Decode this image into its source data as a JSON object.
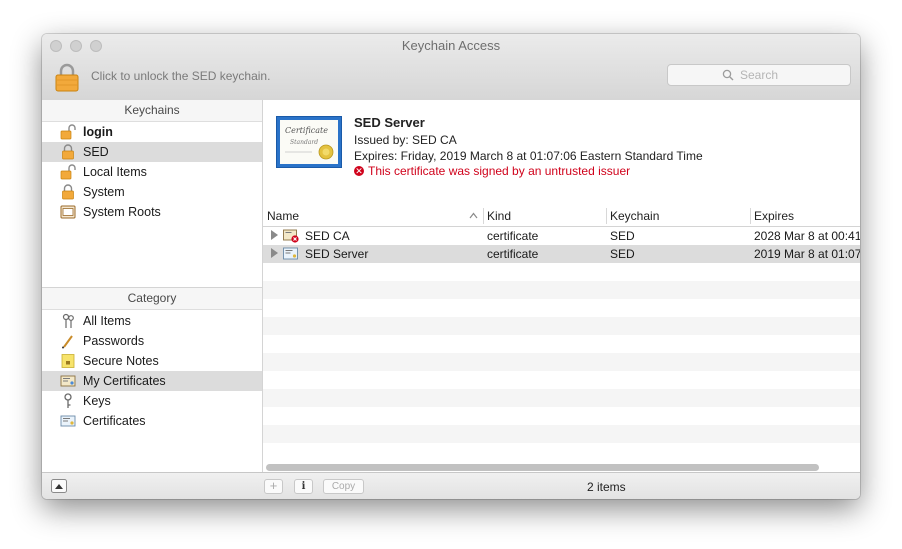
{
  "window": {
    "title": "Keychain Access"
  },
  "toolbar": {
    "unlock_text": "Click to unlock the SED keychain.",
    "search_placeholder": "Search"
  },
  "sidebar": {
    "keychains_header": "Keychains",
    "keychains": [
      {
        "label": "login",
        "icon": "lock-open-icon",
        "bold": true,
        "selected": false
      },
      {
        "label": "SED",
        "icon": "lock-closed-icon",
        "bold": false,
        "selected": true
      },
      {
        "label": "Local Items",
        "icon": "lock-open-icon",
        "bold": false,
        "selected": false
      },
      {
        "label": "System",
        "icon": "lock-closed-icon",
        "bold": false,
        "selected": false
      },
      {
        "label": "System Roots",
        "icon": "cabinet-icon",
        "bold": false,
        "selected": false
      }
    ],
    "category_header": "Category",
    "categories": [
      {
        "label": "All Items",
        "icon": "keys-icon",
        "selected": false
      },
      {
        "label": "Passwords",
        "icon": "pencil-icon",
        "selected": false
      },
      {
        "label": "Secure Notes",
        "icon": "note-icon",
        "selected": false
      },
      {
        "label": "My Certificates",
        "icon": "my-certificate-icon",
        "selected": true
      },
      {
        "label": "Keys",
        "icon": "key-icon",
        "selected": false
      },
      {
        "label": "Certificates",
        "icon": "certificate-icon",
        "selected": false
      }
    ]
  },
  "detail": {
    "name": "SED Server",
    "issued_by": "Issued by: SED CA",
    "expires": "Expires: Friday, 2019 March 8 at 01:07:06 Eastern Standard Time",
    "warning": "This certificate was signed by an untrusted issuer",
    "cert_image_text_1": "Certificate",
    "cert_image_text_2": "Standard"
  },
  "table": {
    "columns": [
      "Name",
      "Kind",
      "Keychain",
      "Expires"
    ],
    "rows": [
      {
        "name": "SED CA",
        "kind": "certificate",
        "keychain": "SED",
        "expires": "2028 Mar 8 at 00:41:",
        "icon": "ca-certificate-icon",
        "selected": false
      },
      {
        "name": "SED Server",
        "kind": "certificate",
        "keychain": "SED",
        "expires": "2019 Mar 8 at 01:07:",
        "icon": "certificate-icon",
        "selected": true
      }
    ]
  },
  "bottombar": {
    "add_label": "+",
    "info_label": "i",
    "copy_label": "Copy",
    "status": "2 items"
  },
  "colors": {
    "selection": "#dcdcdc",
    "warning": "#d0021b",
    "lock": "#f0a82a"
  }
}
